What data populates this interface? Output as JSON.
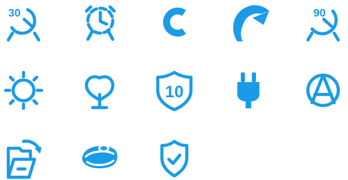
{
  "colors": {
    "accent": "#1a9be8",
    "background": "#ffffff"
  },
  "icons": [
    {
      "name": "alarm-clock-30-icon",
      "label": "30"
    },
    {
      "name": "alarm-clock-timer-icon"
    },
    {
      "name": "letter-c-icon"
    },
    {
      "name": "swirl-curve-icon"
    },
    {
      "name": "alarm-clock-90-icon",
      "label": "90"
    },
    {
      "name": "sun-icon"
    },
    {
      "name": "tree-icon"
    },
    {
      "name": "shield-10-icon",
      "label": "10"
    },
    {
      "name": "power-plug-icon"
    },
    {
      "name": "anarchy-symbol-icon"
    },
    {
      "name": "folder-rotate-icon"
    },
    {
      "name": "soap-bar-icon"
    },
    {
      "name": "shield-check-icon"
    }
  ]
}
